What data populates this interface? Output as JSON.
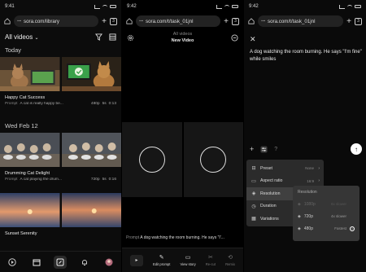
{
  "panel1": {
    "status": {
      "time": "9:41"
    },
    "browser": {
      "url": "sora.com/library",
      "tab_count": "3"
    },
    "header": {
      "title": "All videos"
    },
    "sections": [
      {
        "label": "Today",
        "video_title": "Happy Cat Success",
        "prompt_label": "Prompt",
        "prompt": "A cat is really happy be...",
        "res": "480p",
        "dur": "5s",
        "time": "0:13"
      },
      {
        "label": "Wed Feb 12",
        "video_title": "Drumming Cat Delight",
        "prompt_label": "Prompt",
        "prompt": "A cat playing the drum...",
        "res": "720p",
        "dur": "5s",
        "time": "0:16"
      },
      {
        "label": "",
        "video_title": "Sunset Serenity",
        "prompt_label": "",
        "prompt": "",
        "res": "",
        "dur": "",
        "time": ""
      }
    ]
  },
  "panel2": {
    "status": {
      "time": "9:42"
    },
    "browser": {
      "url": "sora.com/t/task_01jnl",
      "tab_count": "3"
    },
    "header": {
      "subtitle": "All videos",
      "title": "New Video"
    },
    "prompt_label": "Prompt",
    "prompt": "A dog watching the room burning. He says \"I'...",
    "actions": [
      {
        "label": "Edit prompt",
        "icon": "pencil-icon",
        "enabled": true
      },
      {
        "label": "View story",
        "icon": "storyboard-icon",
        "enabled": true
      },
      {
        "label": "Re-cut",
        "icon": "scissors-icon",
        "enabled": false
      },
      {
        "label": "Remix",
        "icon": "remix-icon",
        "enabled": false
      }
    ]
  },
  "panel3": {
    "status": {
      "time": "9:42"
    },
    "browser": {
      "url": "sora.com/t/task_01jnl",
      "tab_count": "3"
    },
    "prompt_text": "A dog watching the room burning. He says \"I'm fine\" while smiles",
    "menu": [
      {
        "label": "Preset",
        "value": "None",
        "icon": "preset-icon"
      },
      {
        "label": "Aspect ratio",
        "value": "16:9",
        "icon": "aspect-ratio-icon"
      },
      {
        "label": "Resolution",
        "value": "",
        "icon": "resolution-icon"
      },
      {
        "label": "Duration",
        "value": "",
        "icon": "duration-icon"
      },
      {
        "label": "Variations",
        "value": "",
        "icon": "variations-icon"
      }
    ],
    "submenu": {
      "title": "Resolution",
      "options": [
        {
          "res": "1080p",
          "note": "8x slower",
          "state": "disabled"
        },
        {
          "res": "720p",
          "note": "4x slower",
          "state": "available"
        },
        {
          "res": "480p",
          "note": "Fastest",
          "state": "selected"
        }
      ]
    }
  },
  "colors": {
    "bg": "#000000",
    "menu": "#2b2b2b",
    "submenu": "#363636"
  }
}
